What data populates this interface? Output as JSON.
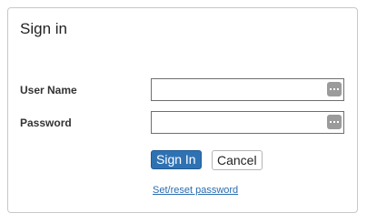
{
  "dialog": {
    "title": "Sign in"
  },
  "form": {
    "username_label": "User Name",
    "username_value": "",
    "username_icon": "more-options-icon",
    "password_label": "Password",
    "password_value": "",
    "password_icon": "more-options-icon"
  },
  "actions": {
    "sign_in_label": "Sign In",
    "cancel_label": "Cancel",
    "reset_link_label": "Set/reset password"
  },
  "colors": {
    "primary": "#2f72b4",
    "link": "#2a6cb0",
    "border": "#c8c8c8"
  }
}
